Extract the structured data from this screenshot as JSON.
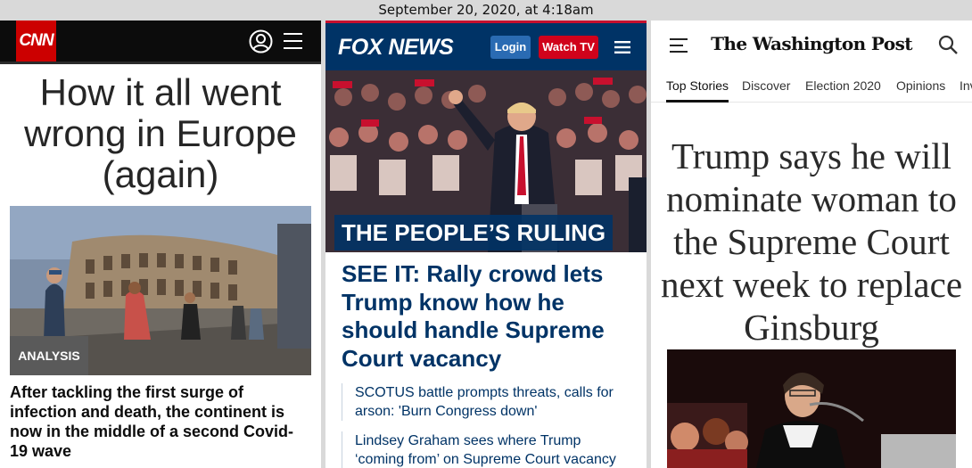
{
  "timestamp": "September 20, 2020, at 4:18am",
  "cnn": {
    "logo": "CNN",
    "title": "How it all went wrong in Europe (again)",
    "badge": "ANALYSIS",
    "summary": "After tackling the first surge of infection and death, the continent is now in the middle of a second Covid-19 wave"
  },
  "fox": {
    "logo": "FOX NEWS",
    "login": "Login",
    "watch": "Watch TV",
    "kicker": "THE PEOPLE’S RULING",
    "headline": "SEE IT: Rally crowd lets Trump know how he should handle Supreme Court vacancy",
    "related": [
      "SCOTUS battle prompts threats, calls for arson: 'Burn Congress down'",
      "Lindsey Graham sees where Trump ‘coming from’ on Supreme Court vacancy"
    ],
    "colors": {
      "navy": "#003366",
      "red": "#d0021b"
    }
  },
  "wapo": {
    "logo": "The Washington Post",
    "tabs": [
      "Top Stories",
      "Discover",
      "Election 2020",
      "Opinions",
      "Inv"
    ],
    "headline": "Trump says he will nominate woman to the Supreme Court next week to replace Ginsburg"
  }
}
